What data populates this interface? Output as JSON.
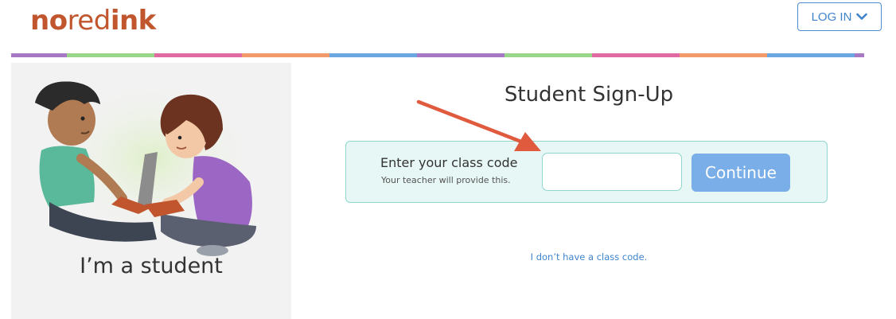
{
  "header": {
    "logo_no": "no",
    "logo_red": "red",
    "logo_ink": "ink",
    "login_label": "LOG IN",
    "login_icon": "chevron-down-icon"
  },
  "rainbow": {
    "colors": [
      "#a779c4",
      "#9ad68a",
      "#e06aa2",
      "#f29a6a",
      "#6aa6e0",
      "#a779c4",
      "#9ad68a",
      "#e06aa2",
      "#f29a6a",
      "#6aa6e0",
      "#a779c4"
    ]
  },
  "left_panel": {
    "label": "I’m a student"
  },
  "signup": {
    "title": "Student Sign-Up",
    "code_label": "Enter your class code",
    "code_hint": "Your teacher will provide this.",
    "code_value": "",
    "continue_label": "Continue",
    "no_code_link": "I don’t have a class code."
  },
  "colors": {
    "brand": "#c0552e",
    "accent": "#3f84cc",
    "button": "#7aaee8",
    "code_box_bg": "#e6f7f5",
    "code_box_border": "#8fd6cf",
    "arrow": "#e05a3e"
  }
}
